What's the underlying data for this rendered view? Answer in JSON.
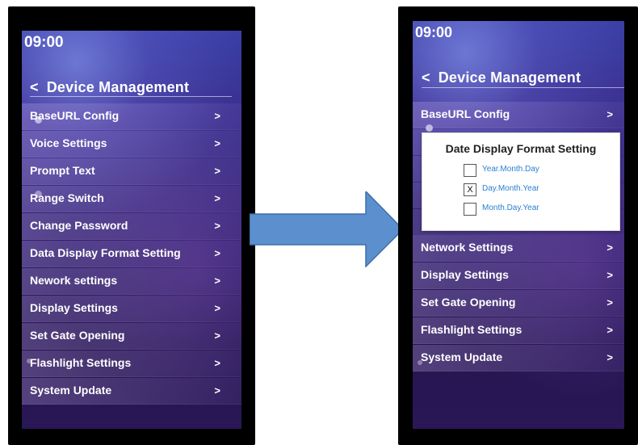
{
  "left_screen": {
    "time": "09:00",
    "back_symbol": "<",
    "title": "Device Management",
    "items": [
      {
        "label": "BaseURL Config",
        "chevron": ">"
      },
      {
        "label": "Voice Settings",
        "chevron": ">"
      },
      {
        "label": "Prompt Text",
        "chevron": ">"
      },
      {
        "label": "Range Switch",
        "chevron": ">"
      },
      {
        "label": "Change Password",
        "chevron": ">"
      },
      {
        "label": "Data Display Format Setting",
        "chevron": ">"
      },
      {
        "label": "Nework settings",
        "chevron": ">"
      },
      {
        "label": "Display Settings",
        "chevron": ">"
      },
      {
        "label": "Set Gate Opening",
        "chevron": ">"
      },
      {
        "label": "Flashlight Settings",
        "chevron": ">"
      },
      {
        "label": "System Update",
        "chevron": ">"
      }
    ]
  },
  "right_screen": {
    "time": "09:00",
    "back_symbol": "<",
    "title": "Device Management",
    "top_items": [
      {
        "label": "BaseURL Config",
        "chevron": ">"
      }
    ],
    "bottom_items": [
      {
        "label": "Network Settings",
        "chevron": ">"
      },
      {
        "label": "Display Settings",
        "chevron": ">"
      },
      {
        "label": "Set Gate Opening",
        "chevron": ">"
      },
      {
        "label": "Flashlight Settings",
        "chevron": ">"
      },
      {
        "label": "System Update",
        "chevron": ">"
      }
    ],
    "dialog": {
      "title": "Date Display Format Setting",
      "options": [
        {
          "label": "Year.Month.Day",
          "checked_mark": ""
        },
        {
          "label": "Day.Month.Year",
          "checked_mark": "X"
        },
        {
          "label": "Month.Day.Year",
          "checked_mark": ""
        }
      ],
      "selected": "Day.Month.Year"
    }
  },
  "colors": {
    "arrow_fill": "#5b8fce",
    "arrow_stroke": "#3e6fa8",
    "option_text": "#2a7fcf",
    "screen_bg_top": "#3a3fa6",
    "screen_bg_bottom": "#241550"
  },
  "icons": {
    "back": "chevron-left-icon",
    "row_chevron": "chevron-right-icon",
    "transition": "right-arrow-icon"
  }
}
